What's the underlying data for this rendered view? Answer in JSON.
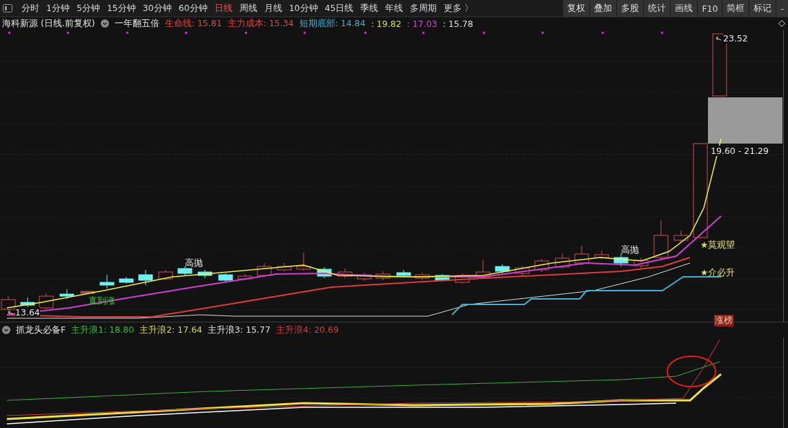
{
  "toolbar": {
    "periods": [
      {
        "label": "分时",
        "selected": false
      },
      {
        "label": "1分钟",
        "selected": false
      },
      {
        "label": "5分钟",
        "selected": false
      },
      {
        "label": "15分钟",
        "selected": false
      },
      {
        "label": "30分钟",
        "selected": false
      },
      {
        "label": "60分钟",
        "selected": false
      },
      {
        "label": "日线",
        "selected": true
      },
      {
        "label": "周线",
        "selected": false
      },
      {
        "label": "月线",
        "selected": false
      },
      {
        "label": "10分钟",
        "selected": false
      },
      {
        "label": "45日线",
        "selected": false
      },
      {
        "label": "季线",
        "selected": false
      },
      {
        "label": "年线",
        "selected": false
      },
      {
        "label": "多周期",
        "selected": false
      },
      {
        "label": "更多 〉",
        "selected": false
      }
    ],
    "tools": [
      "复权",
      "叠加",
      "多股",
      "统计",
      "画线",
      "F10",
      "简框",
      "标记",
      "-"
    ]
  },
  "main_chart": {
    "legend": {
      "title": "海科新源 (日线.前复权)",
      "indicator": "一年翻五倍",
      "values": [
        {
          "text": "生命线: 15.81",
          "color": "#e8453c"
        },
        {
          "text": "主力成本: 15.34",
          "color": "#e8453c"
        },
        {
          "text": "短期底部: 14.84",
          "color": "#3fb0d8"
        },
        {
          "text": ": 19.82",
          "color": "#dede48"
        },
        {
          "text": ": 17.03",
          "color": "#d048d0"
        },
        {
          "text": ": 15.78",
          "color": "#e0e0e0"
        }
      ]
    },
    "annotations": [
      {
        "text": "13.64",
        "kind": "price"
      },
      {
        "text": "直到涨",
        "kind": "signal"
      },
      {
        "text": "高抛",
        "kind": "note"
      },
      {
        "text": "高抛",
        "kind": "note"
      },
      {
        "text": "★莫观望",
        "kind": "star"
      },
      {
        "text": "★介必升",
        "kind": "star"
      },
      {
        "text": "涨榜",
        "kind": "badge"
      },
      {
        "text": "23.52",
        "kind": "price"
      },
      {
        "text": "19.60 - 21.29",
        "kind": "range"
      }
    ]
  },
  "sub_chart": {
    "legend": {
      "title": "抓龙头必备F",
      "values": [
        {
          "text": "主升浪1: 18.80",
          "color": "#3cbc3c"
        },
        {
          "text": "主升浪2: 17.64",
          "color": "#d8d840"
        },
        {
          "text": "主升浪3: 15.77",
          "color": "#e0e0e0"
        },
        {
          "text": "主升浪4: 20.69",
          "color": "#d83c3c"
        }
      ]
    }
  }
}
